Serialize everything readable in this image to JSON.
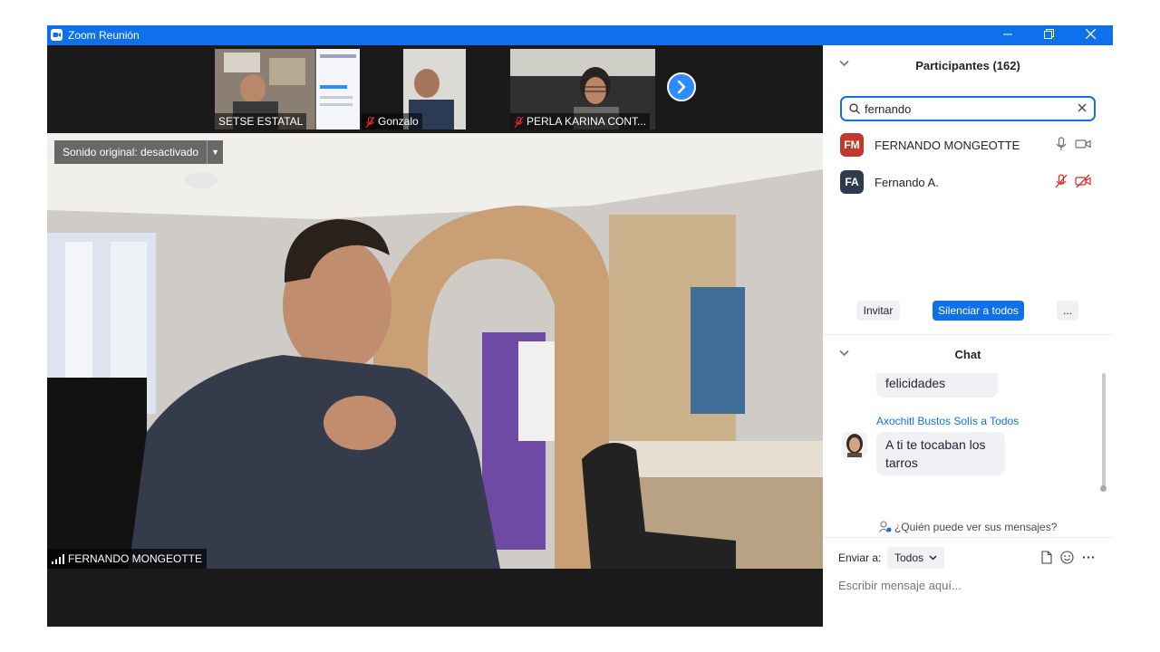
{
  "window": {
    "title": "Zoom Reunión"
  },
  "gallery": {
    "thumbs": [
      {
        "name": "SETSE ESTATAL",
        "muted": false
      },
      {
        "name": "Gonzalo",
        "muted": true
      },
      {
        "name": "PERLA KARINA CONT...",
        "muted": true
      }
    ]
  },
  "main_video": {
    "sound_label": "Sonido original: desactivado",
    "speaker_name": "FERNANDO MONGEOTTE"
  },
  "participants": {
    "title": "Participantes (162)",
    "search_value": "fernando",
    "list": [
      {
        "initials": "FM",
        "name": "FERNANDO MONGEOTTE",
        "color": "#c0392b",
        "audio": "on",
        "video": "on"
      },
      {
        "initials": "FA",
        "name": "Fernando A.",
        "color": "#2e3b4e",
        "audio": "muted",
        "video": "off"
      }
    ],
    "invite_label": "Invitar",
    "mute_all_label": "Silenciar a todos",
    "more_label": "..."
  },
  "chat": {
    "title": "Chat",
    "messages": [
      {
        "text": "felicidades"
      },
      {
        "sender": "Axochitl Bustos Solís a Todos",
        "text_line1": "A ti te tocaban los",
        "text_line2": "tarros"
      }
    ],
    "who_can_see": "¿Quién puede ver sus mensajes?",
    "send_to_label": "Enviar a:",
    "send_to_value": "Todos",
    "input_placeholder": "Escribir mensaje aquí..."
  },
  "colors": {
    "zoom_blue": "#0e71eb",
    "accent_blue": "#2d8cff",
    "muted_red": "#e02828"
  }
}
